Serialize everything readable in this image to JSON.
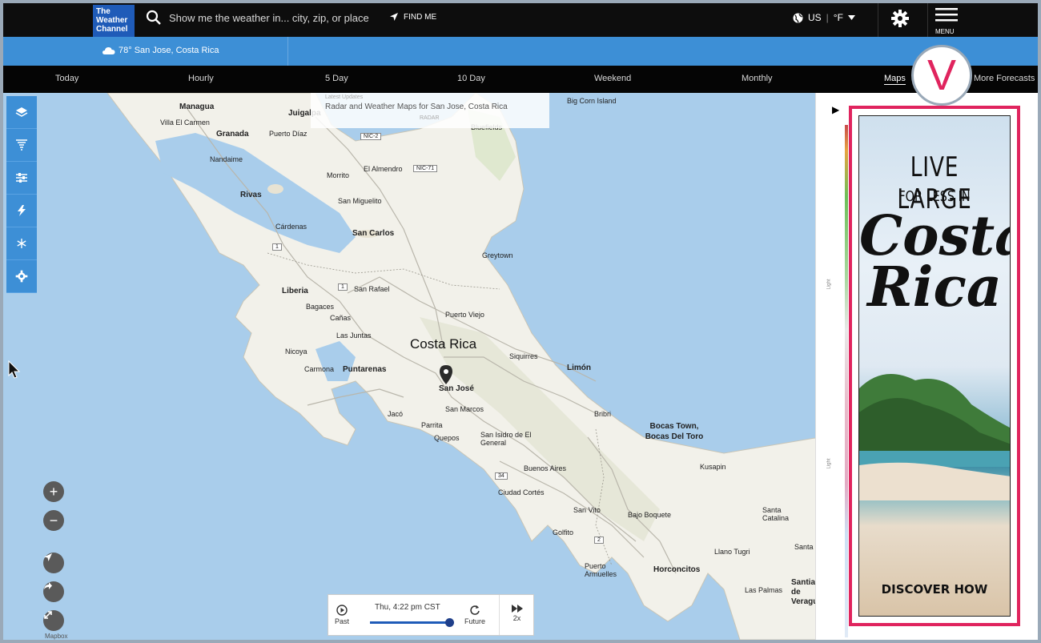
{
  "header": {
    "logo_line1": "The",
    "logo_line2": "Weather",
    "logo_line3": "Channel",
    "search_placeholder": "Show me the weather in... city, zip, or place",
    "find_me": "FIND ME",
    "units_country": "US",
    "units_temp": "°F",
    "menu_label": "MENU"
  },
  "location": {
    "current": "78° San Jose, Costa Rica"
  },
  "nav": {
    "tabs": [
      "Today",
      "Hourly",
      "5 Day",
      "10 Day",
      "Weekend",
      "Monthly",
      "Maps",
      "More Forecasts"
    ],
    "active": "Maps"
  },
  "map": {
    "tooltip_small": "Latest Updates",
    "tooltip_title": "Radar and Weather Maps for San Jose, Costa Rica",
    "tooltip_sub": "RADAR",
    "country_label": "Costa Rica",
    "places": [
      "Managua",
      "Juigalpa",
      "Villa El Carmen",
      "Granada",
      "Puerto Díaz",
      "Nandaime",
      "Morrito",
      "El Almendro",
      "Big Corn Island",
      "Bluefields",
      "Rivas",
      "San Miguelito",
      "Cárdenas",
      "San Carlos",
      "Greytown",
      "Liberia",
      "San Rafael",
      "Bagaces",
      "Cañas",
      "Puerto Viejo",
      "Las Juntas",
      "Nicoya",
      "Siquirres",
      "Limón",
      "Carmona",
      "Puntarenas",
      "San José",
      "Jacó",
      "San Marcos",
      "Parrita",
      "Quepos",
      "San Isidro de El General",
      "Bribri",
      "Bocas Town, Bocas Del Toro",
      "Buenos Aires",
      "Kusapin",
      "Ciudad Cortés",
      "San Vito",
      "Bajo Boquete",
      "Santa Catalina",
      "Golfito",
      "Llano Tugri",
      "Santa F",
      "Puerto Armuelles",
      "Horconcitos",
      "Las Palmas",
      "Santiago de Veraguas"
    ],
    "road_labels": [
      "NIC-2",
      "NIC-71",
      "1",
      "1",
      "34",
      "2"
    ],
    "zoom_in": "+",
    "zoom_out": "−",
    "attribution": "Mapbox"
  },
  "timeline": {
    "past": "Past",
    "time": "Thu, 4:22 pm CST",
    "future": "Future",
    "speed": "2x"
  },
  "legend": {
    "label1": "Light",
    "label2": "Light"
  },
  "ad": {
    "line1": "LIVE LARGE",
    "line2": "FOR LESS IN",
    "line3": "Costa",
    "line4": "Rica",
    "cta": "DISCOVER HOW"
  },
  "badge": {
    "letter": "V"
  },
  "colors": {
    "header_bg": "#0d0d0d",
    "location_bar": "#3d8fd6",
    "logo_bg": "#1f5bb8",
    "ad_border": "#e0245e",
    "water": "#a9cdeb",
    "land": "#f2f1ea"
  }
}
